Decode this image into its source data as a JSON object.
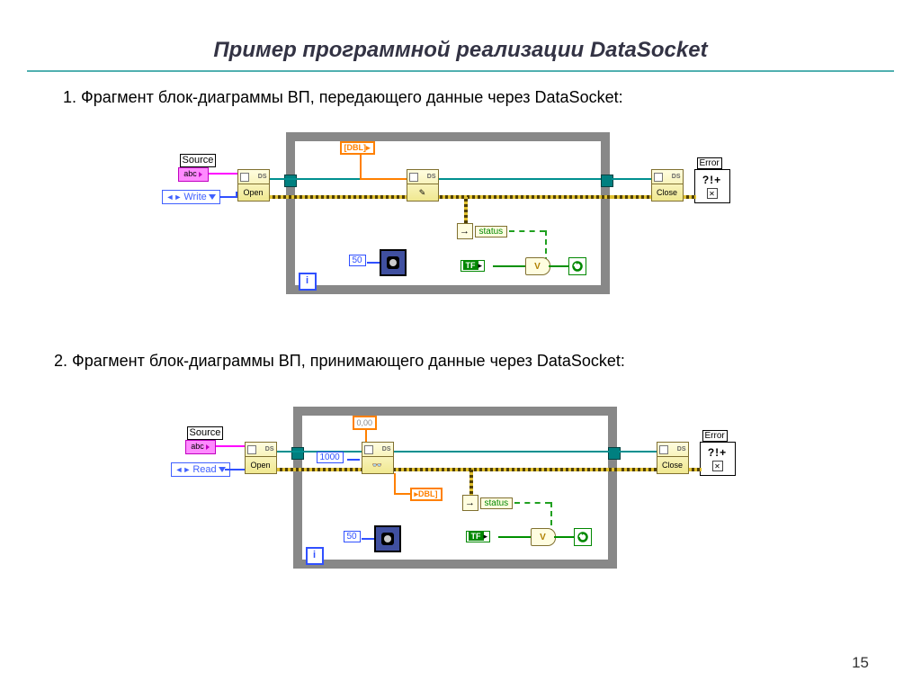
{
  "title": "Пример программной реализации DataSocket",
  "section1": "1. Фрагмент блок-диаграммы ВП, передающего данные через DataSocket:",
  "section2": "2. Фрагмент блок-диаграммы ВП, принимающего данные через DataSocket:",
  "page_number": "15",
  "labels": {
    "source": "Source",
    "abc": "abc",
    "write": "Write",
    "read": "Read",
    "open": "Open",
    "close": "Close",
    "ds": "DS",
    "error": "Error",
    "error_sym": "?!+",
    "status": "status",
    "dbl": "DBL",
    "dbl_arr": "[DBL]",
    "tf": "TF",
    "or": "V",
    "i": "i",
    "const50": "50",
    "const1000": "1000",
    "zero": "0,00",
    "write_icon": "✎"
  }
}
